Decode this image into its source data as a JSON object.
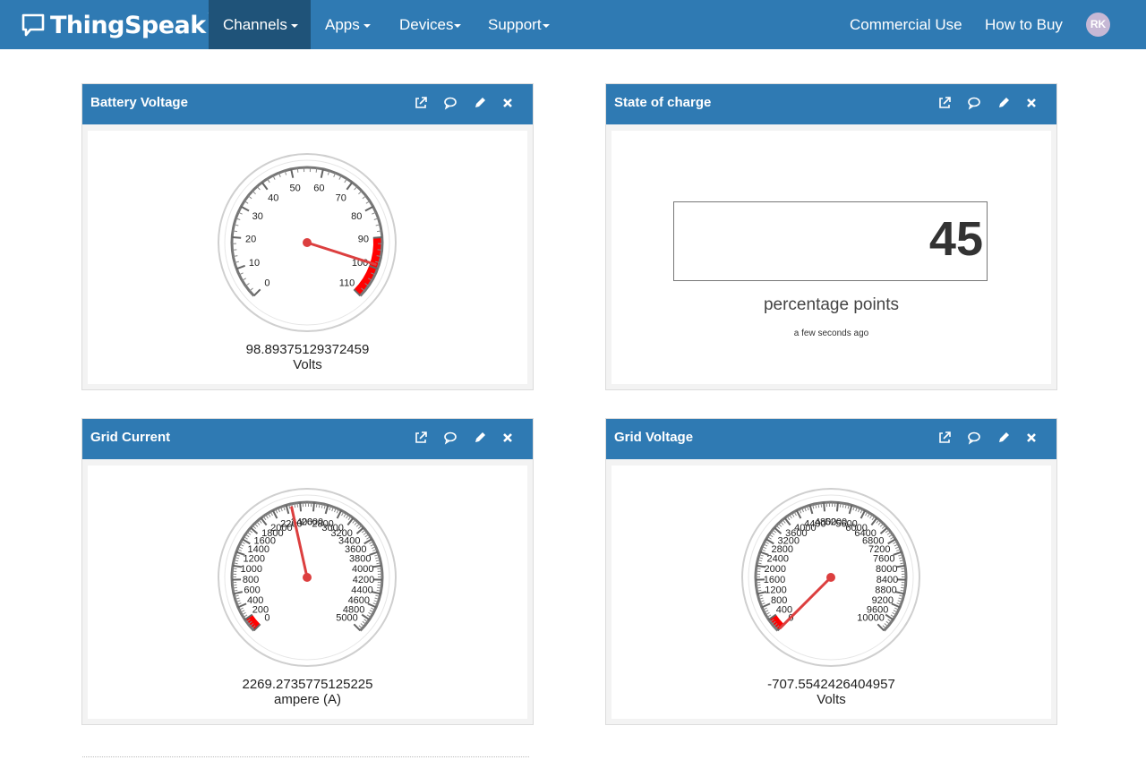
{
  "nav": {
    "brand": "ThingSpeak",
    "trademark": "™",
    "channels": "Channels",
    "apps": "Apps",
    "devices": "Devices",
    "support": "Support",
    "commercial": "Commercial Use",
    "how_to_buy": "How to Buy",
    "avatar_initials": "RK"
  },
  "widgets": {
    "battery": {
      "title": "Battery Voltage",
      "value": "98.89375129372459",
      "unit": "Volts",
      "gauge": {
        "min": 0,
        "max": 110,
        "step": 10,
        "value": 98.89375129372459,
        "danger_from": 90,
        "danger_to": 110,
        "danger_color": "#ff0000"
      }
    },
    "charge": {
      "title": "State of charge",
      "value": "45",
      "unit": "percentage points",
      "time": "a few seconds ago"
    },
    "current": {
      "title": "Grid Current",
      "value": "2269.2735775125225",
      "unit": "ampere (A)",
      "gauge": {
        "min": 0,
        "max": 5000,
        "step": 200,
        "value": 2269.2735775125225,
        "danger_from": 0,
        "danger_to": 200,
        "danger_color": "#ff0000"
      }
    },
    "voltage": {
      "title": "Grid Voltage",
      "value": "-707.5542426404957",
      "unit": "Volts",
      "gauge": {
        "min": 0,
        "max": 10000,
        "step": 400,
        "value": -707.5542426404957,
        "danger_from": 0,
        "danger_to": 400,
        "danger_color": "#ff0000"
      }
    }
  },
  "colors": {
    "header": "#2f7ab3",
    "active_nav": "#1f5379",
    "needle": "#dc3f3f"
  }
}
